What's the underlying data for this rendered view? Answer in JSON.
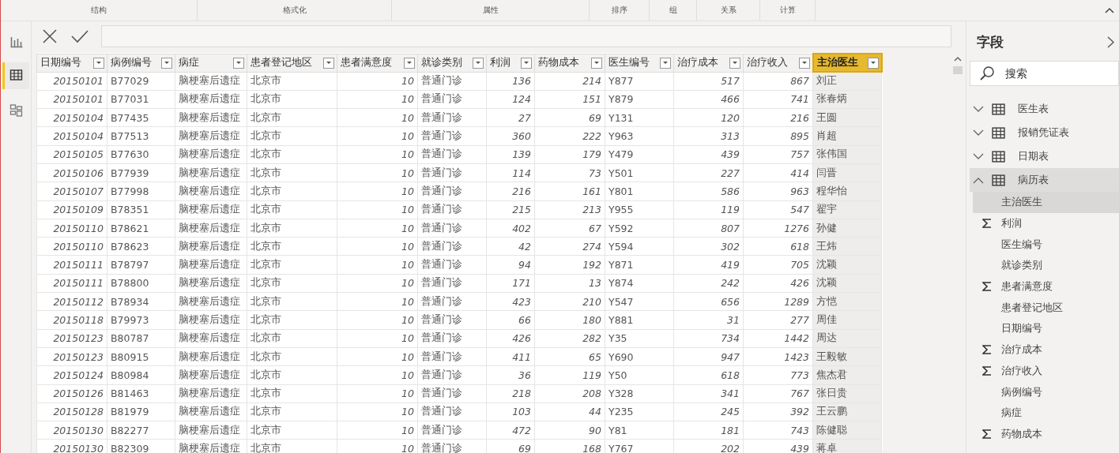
{
  "ribbon": {
    "groups": [
      {
        "label": "结构"
      },
      {
        "label": "格式化"
      },
      {
        "label": "属性"
      },
      {
        "label": "排序"
      },
      {
        "label": "组"
      },
      {
        "label": "关系"
      },
      {
        "label": "计算"
      }
    ]
  },
  "nav": [
    {
      "kind": "report",
      "selected": false
    },
    {
      "kind": "data",
      "selected": true
    },
    {
      "kind": "model",
      "selected": false
    }
  ],
  "table": {
    "columns": [
      {
        "label": "日期编号",
        "kind": "number",
        "selected": false
      },
      {
        "label": "病例编号",
        "kind": "text",
        "selected": false
      },
      {
        "label": "病症",
        "kind": "text",
        "selected": false
      },
      {
        "label": "患者登记地区",
        "kind": "text",
        "selected": false
      },
      {
        "label": "患者满意度",
        "kind": "number",
        "selected": false
      },
      {
        "label": "就诊类别",
        "kind": "text",
        "selected": false
      },
      {
        "label": "利润",
        "kind": "number",
        "selected": false
      },
      {
        "label": "药物成本",
        "kind": "number",
        "selected": false
      },
      {
        "label": "医生编号",
        "kind": "text",
        "selected": false
      },
      {
        "label": "治疗成本",
        "kind": "number",
        "selected": false
      },
      {
        "label": "治疗收入",
        "kind": "number",
        "selected": false
      },
      {
        "label": "主治医生",
        "kind": "text",
        "selected": true
      }
    ],
    "rows": [
      [
        "20150101",
        "B77029",
        "脑梗塞后遗症",
        "北京市",
        "10",
        "普通门诊",
        "136",
        "214",
        "Y877",
        "517",
        "867",
        "刘正"
      ],
      [
        "20150101",
        "B77031",
        "脑梗塞后遗症",
        "北京市",
        "10",
        "普通门诊",
        "124",
        "151",
        "Y879",
        "466",
        "741",
        "张春炳"
      ],
      [
        "20150104",
        "B77435",
        "脑梗塞后遗症",
        "北京市",
        "10",
        "普通门诊",
        "27",
        "69",
        "Y131",
        "120",
        "216",
        "王圆"
      ],
      [
        "20150104",
        "B77513",
        "脑梗塞后遗症",
        "北京市",
        "10",
        "普通门诊",
        "360",
        "222",
        "Y963",
        "313",
        "895",
        "肖超"
      ],
      [
        "20150105",
        "B77630",
        "脑梗塞后遗症",
        "北京市",
        "10",
        "普通门诊",
        "139",
        "179",
        "Y479",
        "439",
        "757",
        "张伟国"
      ],
      [
        "20150106",
        "B77939",
        "脑梗塞后遗症",
        "北京市",
        "10",
        "普通门诊",
        "114",
        "73",
        "Y501",
        "227",
        "414",
        "闫晋"
      ],
      [
        "20150107",
        "B77998",
        "脑梗塞后遗症",
        "北京市",
        "10",
        "普通门诊",
        "216",
        "161",
        "Y801",
        "586",
        "963",
        "程华怡"
      ],
      [
        "20150109",
        "B78351",
        "脑梗塞后遗症",
        "北京市",
        "10",
        "普通门诊",
        "215",
        "213",
        "Y955",
        "119",
        "547",
        "翟宇"
      ],
      [
        "20150110",
        "B78621",
        "脑梗塞后遗症",
        "北京市",
        "10",
        "普通门诊",
        "402",
        "67",
        "Y592",
        "807",
        "1276",
        "孙健"
      ],
      [
        "20150110",
        "B78623",
        "脑梗塞后遗症",
        "北京市",
        "10",
        "普通门诊",
        "42",
        "274",
        "Y594",
        "302",
        "618",
        "王炜"
      ],
      [
        "20150111",
        "B78797",
        "脑梗塞后遗症",
        "北京市",
        "10",
        "普通门诊",
        "94",
        "192",
        "Y871",
        "419",
        "705",
        "沈颖"
      ],
      [
        "20150111",
        "B78800",
        "脑梗塞后遗症",
        "北京市",
        "10",
        "普通门诊",
        "171",
        "13",
        "Y874",
        "242",
        "426",
        "沈颖"
      ],
      [
        "20150112",
        "B78934",
        "脑梗塞后遗症",
        "北京市",
        "10",
        "普通门诊",
        "423",
        "210",
        "Y547",
        "656",
        "1289",
        "方恺"
      ],
      [
        "20150118",
        "B79973",
        "脑梗塞后遗症",
        "北京市",
        "10",
        "普通门诊",
        "66",
        "180",
        "Y881",
        "31",
        "277",
        "周佳"
      ],
      [
        "20150123",
        "B80787",
        "脑梗塞后遗症",
        "北京市",
        "10",
        "普通门诊",
        "426",
        "282",
        "Y35",
        "734",
        "1442",
        "周达"
      ],
      [
        "20150123",
        "B80915",
        "脑梗塞后遗症",
        "北京市",
        "10",
        "普通门诊",
        "411",
        "65",
        "Y690",
        "947",
        "1423",
        "王毅敏"
      ],
      [
        "20150124",
        "B80984",
        "脑梗塞后遗症",
        "北京市",
        "10",
        "普通门诊",
        "36",
        "119",
        "Y50",
        "618",
        "773",
        "焦杰君"
      ],
      [
        "20150126",
        "B81463",
        "脑梗塞后遗症",
        "北京市",
        "10",
        "普通门诊",
        "218",
        "208",
        "Y328",
        "341",
        "767",
        "张日贵"
      ],
      [
        "20150128",
        "B81979",
        "脑梗塞后遗症",
        "北京市",
        "10",
        "普通门诊",
        "103",
        "44",
        "Y235",
        "245",
        "392",
        "王云鹏"
      ],
      [
        "20150130",
        "B82277",
        "脑梗塞后遗症",
        "北京市",
        "10",
        "普通门诊",
        "472",
        "90",
        "Y81",
        "181",
        "743",
        "陈健聪"
      ],
      [
        "20150130",
        "B82309",
        "脑梗塞后遗症",
        "北京市",
        "10",
        "普通门诊",
        "69",
        "168",
        "Y767",
        "202",
        "439",
        "蒋卓"
      ]
    ]
  },
  "fields_pane": {
    "title": "字段",
    "search": {
      "placeholder": "搜索"
    },
    "tables": [
      {
        "label": "医生表",
        "expanded": false,
        "selected": false
      },
      {
        "label": "报销凭证表",
        "expanded": false,
        "selected": false
      },
      {
        "label": "日期表",
        "expanded": false,
        "selected": false
      },
      {
        "label": "病历表",
        "expanded": true,
        "selected": true,
        "children": [
          {
            "label": "主治医生",
            "kind": "text",
            "selected": true
          },
          {
            "label": "利润",
            "kind": "sum",
            "selected": false
          },
          {
            "label": "医生编号",
            "kind": "text",
            "selected": false
          },
          {
            "label": "就诊类别",
            "kind": "text",
            "selected": false
          },
          {
            "label": "患者满意度",
            "kind": "sum",
            "selected": false
          },
          {
            "label": "患者登记地区",
            "kind": "text",
            "selected": false
          },
          {
            "label": "日期编号",
            "kind": "text",
            "selected": false
          },
          {
            "label": "治疗成本",
            "kind": "sum",
            "selected": false
          },
          {
            "label": "治疗收入",
            "kind": "sum",
            "selected": false
          },
          {
            "label": "病例编号",
            "kind": "text",
            "selected": false
          },
          {
            "label": "病症",
            "kind": "text",
            "selected": false
          },
          {
            "label": "药物成本",
            "kind": "sum",
            "selected": false
          }
        ]
      }
    ]
  }
}
